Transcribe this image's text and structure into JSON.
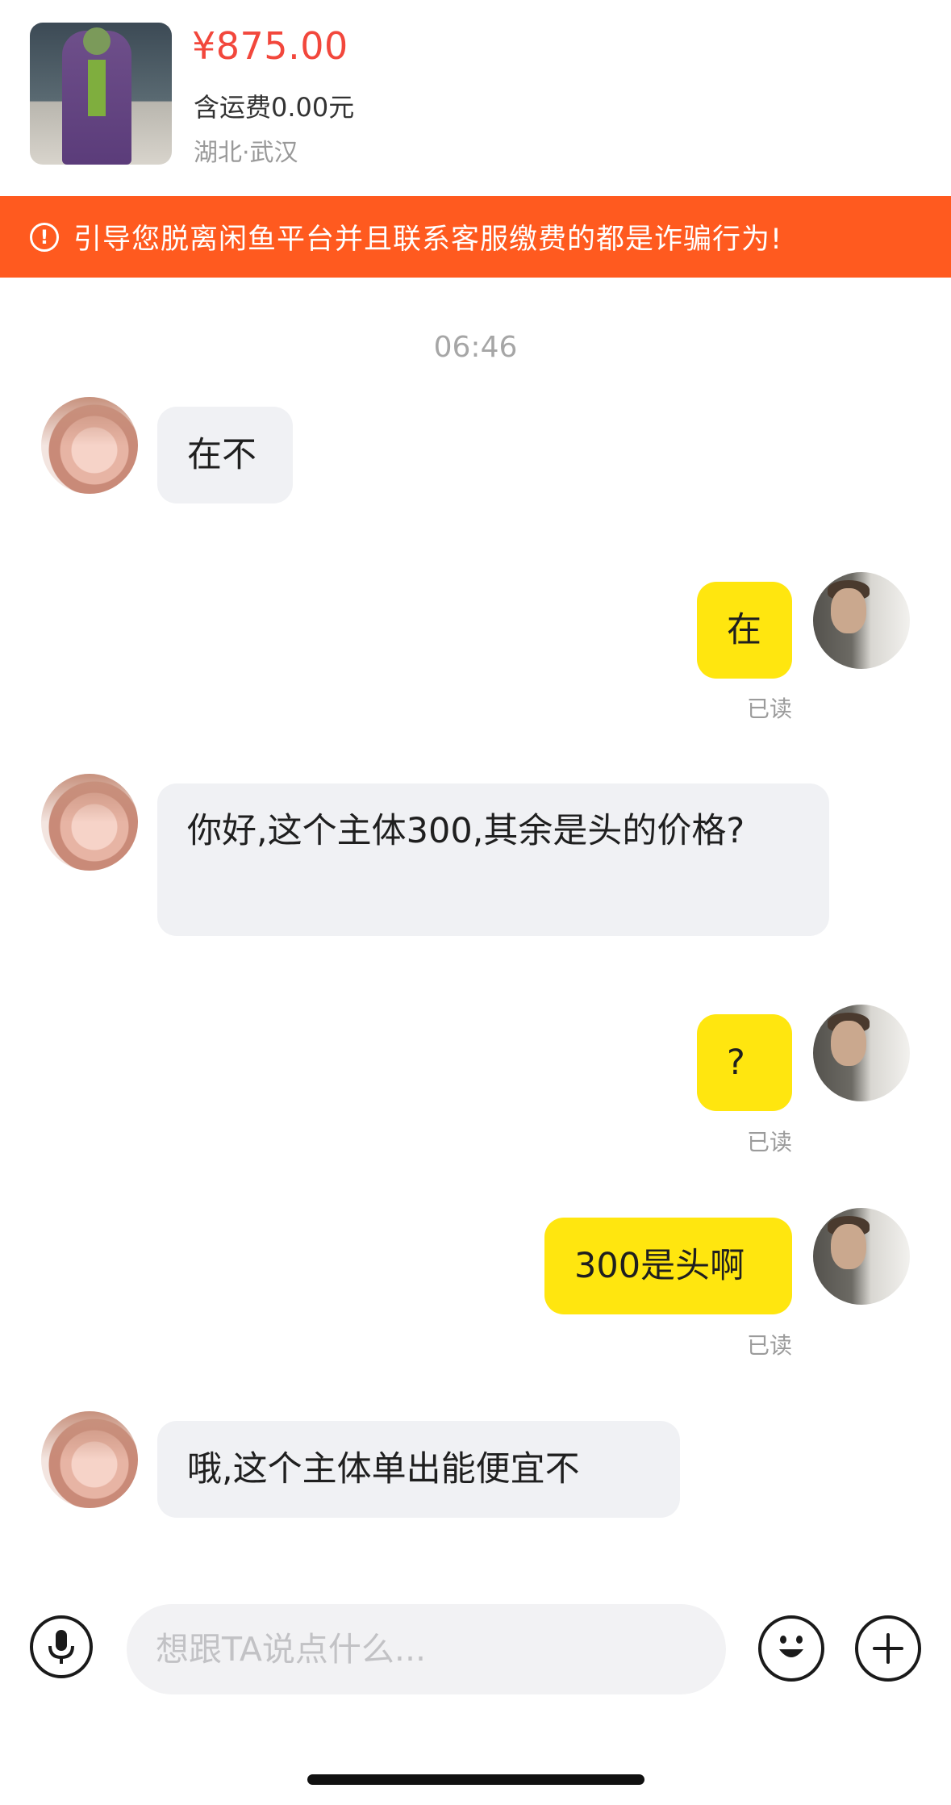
{
  "product": {
    "price": "¥875.00",
    "shipping": "含运费0.00元",
    "location": "湖北·武汉"
  },
  "warning": {
    "icon": "alert-circle-icon",
    "text": "引导您脱离闲鱼平台并且联系客服缴费的都是诈骗行为!"
  },
  "chat": {
    "timestamp": "06:46",
    "messages": [
      {
        "sender": "other",
        "text": "在不"
      },
      {
        "sender": "self",
        "text": "在",
        "status": "已读"
      },
      {
        "sender": "other",
        "text": "你好,这个主体300,其余是头的价格?"
      },
      {
        "sender": "self",
        "text": "?",
        "status": "已读"
      },
      {
        "sender": "self",
        "text": "300是头啊",
        "status": "已读"
      },
      {
        "sender": "other",
        "text": "哦,这个主体单出能便宜不"
      }
    ]
  },
  "input_bar": {
    "placeholder": "想跟TA说点什么...",
    "voice_icon": "microphone-icon",
    "emoji_icon": "smiley-icon",
    "add_icon": "plus-icon"
  },
  "colors": {
    "price": "#f2473c",
    "warning_bg": "#ff5a1f",
    "self_bubble": "#ffe60f",
    "other_bubble": "#f0f1f4"
  }
}
